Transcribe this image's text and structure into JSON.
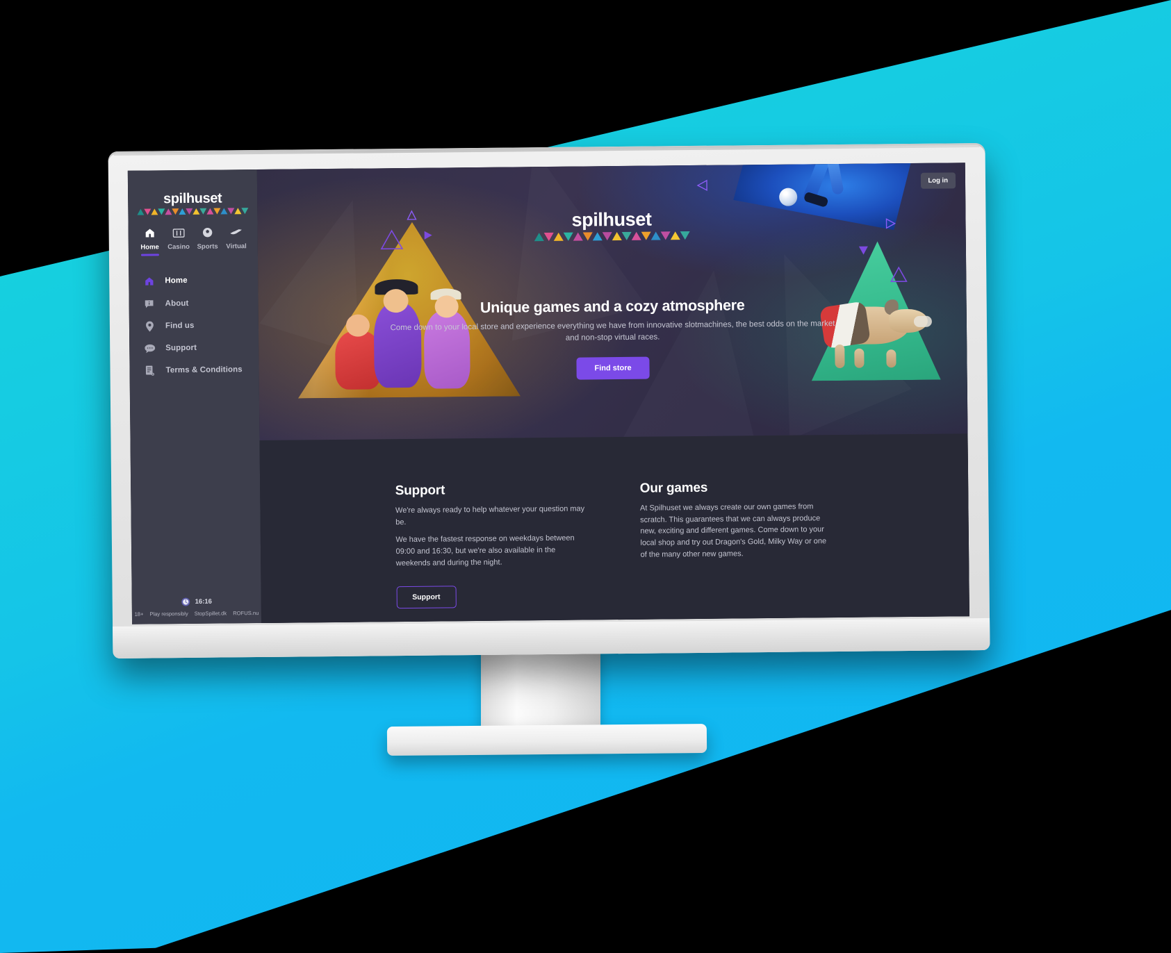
{
  "brand": {
    "name": "spilhuset",
    "accent": "#7b4ae8",
    "sidebar_bg": "#3d3e4c",
    "content_bg": "#282936"
  },
  "sidebar": {
    "logo": "spilhuset",
    "tabs": [
      {
        "label": "Home",
        "icon": "home-icon",
        "active": true
      },
      {
        "label": "Casino",
        "icon": "slot-machine-icon",
        "active": false
      },
      {
        "label": "Sports",
        "icon": "football-icon",
        "active": false
      },
      {
        "label": "Virtual",
        "icon": "greyhound-icon",
        "active": false
      }
    ],
    "nav": [
      {
        "label": "Home",
        "icon": "home-icon",
        "active": true
      },
      {
        "label": "About",
        "icon": "info-chat-icon",
        "active": false
      },
      {
        "label": "Find us",
        "icon": "map-pin-icon",
        "active": false
      },
      {
        "label": "Support",
        "icon": "chat-bubble-icon",
        "active": false
      },
      {
        "label": "Terms & Conditions",
        "icon": "document-icon",
        "active": false
      }
    ],
    "footer": {
      "clock_icon": "clock-icon",
      "time": "16:16",
      "legal": [
        "18+",
        "Play responsibly",
        "StopSpillet.dk",
        "ROFUS.nu"
      ]
    }
  },
  "topbar": {
    "login_label": "Log in"
  },
  "hero": {
    "logo": "spilhuset",
    "title": "Unique games and a cozy atmosphere",
    "subtitle": "Come down to your local store and experience everything we have from innovative slotmachines, the best odds on the market and non-stop virtual races.",
    "cta_label": "Find store",
    "artwork": [
      "pirate-characters-gold-triangle",
      "football-player-image",
      "greyhound-green-triangle",
      "decorative-triangles"
    ]
  },
  "content": {
    "columns": [
      {
        "heading": "Support",
        "paragraphs": [
          "We're always ready to help whatever your question may be.",
          "We have the fastest response on weekdays between 09:00 and 16:30, but we're also available in the weekends and during the night."
        ],
        "button": "Support"
      },
      {
        "heading": "Our games",
        "paragraphs": [
          "At Spilhuset we always create our own games from scratch. This guarantees that we can always produce new, exciting and different games. Come down to your local shop and try out Dragon's Gold, Milky Way or one of the many other new games."
        ],
        "button": null
      }
    ]
  },
  "logo_band_colors": [
    "#1f8f8a",
    "#e1508f",
    "#f0b429",
    "#2bb3a3",
    "#c44fa0",
    "#e88c2b",
    "#2f9fd6",
    "#b84b9e",
    "#f2c230",
    "#3aa99a",
    "#d6519b",
    "#eda02c",
    "#2e8fc9",
    "#c04fa2",
    "#f3c733",
    "#36a89c"
  ]
}
